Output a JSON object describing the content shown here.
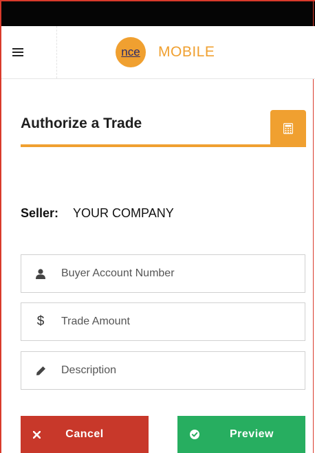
{
  "header": {
    "menu_icon": "hamburger-icon",
    "logo_mark": "nce",
    "logo_text": "MOBILE",
    "brand_color": "#f0a030"
  },
  "page": {
    "title": "Authorize a Trade",
    "calculator_icon": "calculator-icon"
  },
  "seller": {
    "label": "Seller:",
    "value": "YOUR COMPANY"
  },
  "form": {
    "buyer_account": {
      "placeholder": "Buyer Account Number",
      "value": "",
      "icon": "user-icon"
    },
    "trade_amount": {
      "placeholder": "Trade Amount",
      "value": "",
      "icon": "dollar-icon"
    },
    "description": {
      "placeholder": "Description",
      "value": "",
      "icon": "pencil-icon"
    }
  },
  "actions": {
    "cancel": {
      "label": "Cancel",
      "icon": "times-icon",
      "color": "#c8382a"
    },
    "preview": {
      "label": "Preview",
      "icon": "check-circle-icon",
      "color": "#27ae60"
    }
  }
}
